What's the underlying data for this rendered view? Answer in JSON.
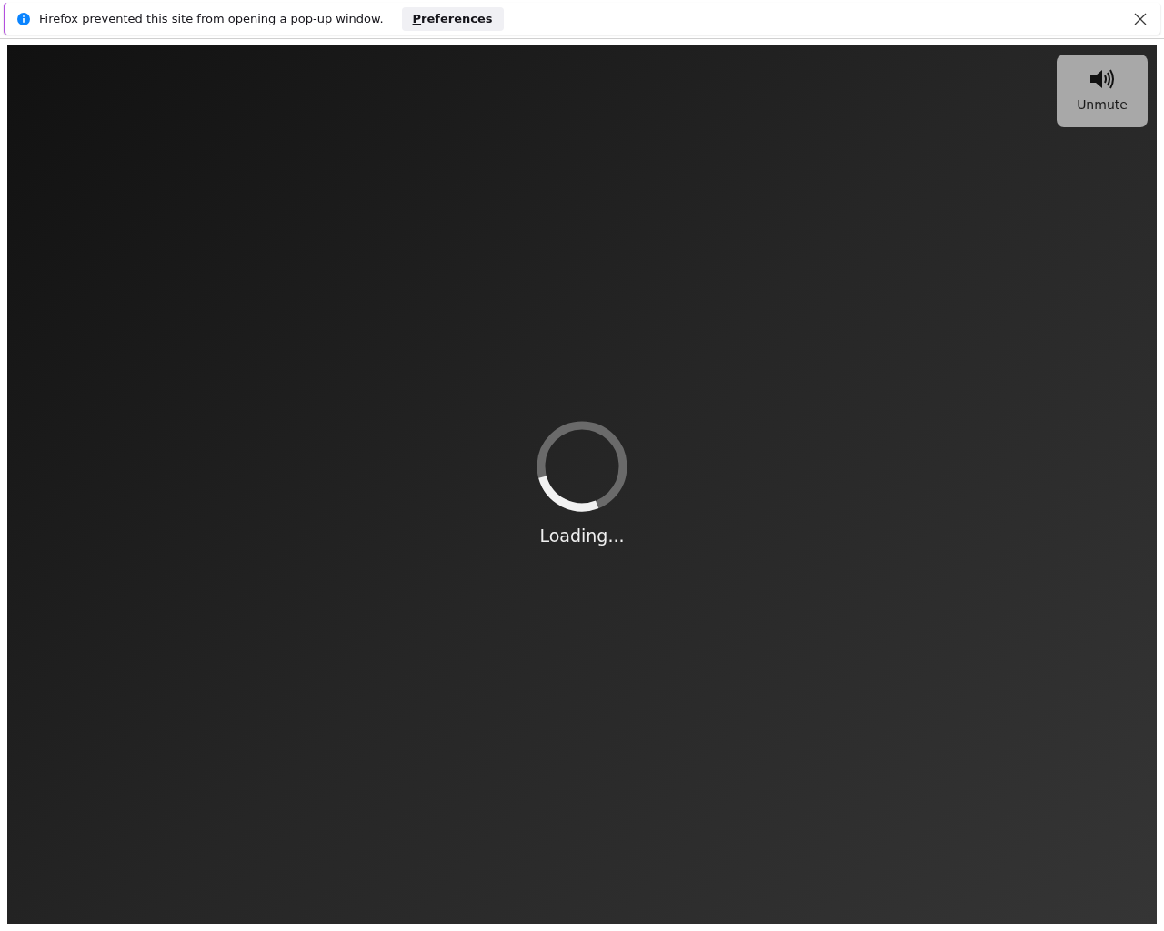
{
  "notification": {
    "message": "Firefox prevented this site from opening a pop-up window.",
    "button": {
      "label": "Preferences",
      "underline_first": true
    }
  },
  "player": {
    "unmute_button": {
      "label": "Unmute"
    },
    "loading_text": "Loading..."
  }
}
